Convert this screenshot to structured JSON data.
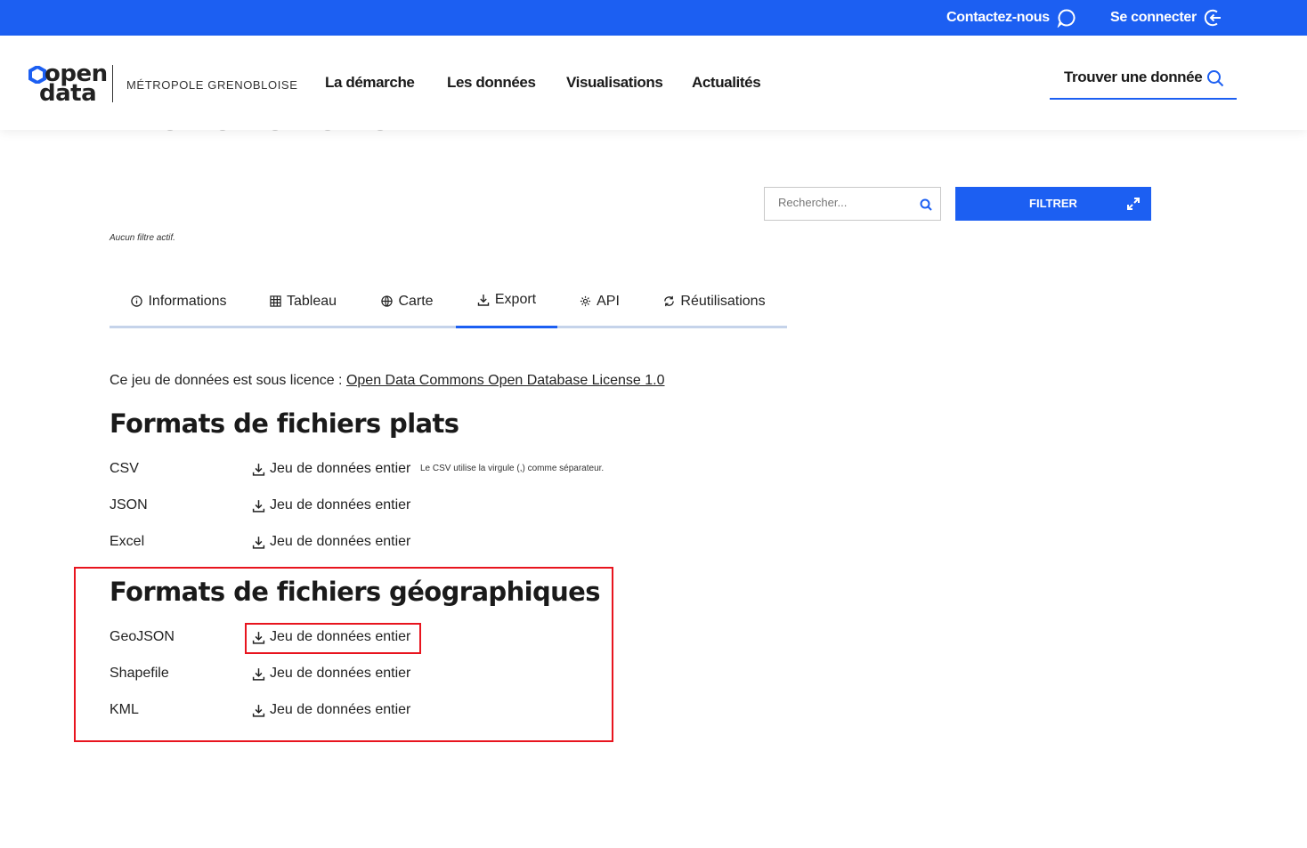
{
  "topbar": {
    "contact_label": "Contactez-nous",
    "contact_icon": "chat-bubble-icon",
    "login_label": "Se connecter",
    "login_icon": "login-arrow-icon"
  },
  "header": {
    "logo_line1": "open",
    "logo_line2": "data",
    "logo_subtitle": "MÉTROPOLE GRENOBLOISE",
    "nav": [
      "La démarche",
      "Les données",
      "Visualisations",
      "Actualités"
    ],
    "find_label": "Trouver une donnée"
  },
  "filters": {
    "search_placeholder": "Rechercher...",
    "filter_button": "FILTRER",
    "no_filter_text": "Aucun filtre actif."
  },
  "tabs": [
    {
      "label": "Informations",
      "icon": "info-circle-icon",
      "active": false
    },
    {
      "label": "Tableau",
      "icon": "table-grid-icon",
      "active": false
    },
    {
      "label": "Carte",
      "icon": "globe-icon",
      "active": false
    },
    {
      "label": "Export",
      "icon": "download-icon",
      "active": true
    },
    {
      "label": "API",
      "icon": "gear-icon",
      "active": false
    },
    {
      "label": "Réutilisations",
      "icon": "refresh-icon",
      "active": false
    }
  ],
  "content": {
    "licence_prefix": "Ce jeu de données est sous licence : ",
    "licence_link": "Open Data Commons Open Database License 1.0",
    "flat_title": "Formats de fichiers plats",
    "flat_formats": [
      {
        "name": "CSV",
        "link": "Jeu de données entier",
        "note": "Le CSV utilise la virgule (,) comme séparateur."
      },
      {
        "name": "JSON",
        "link": "Jeu de données entier"
      },
      {
        "name": "Excel",
        "link": "Jeu de données entier"
      }
    ],
    "geo_title": "Formats de fichiers géographiques",
    "geo_formats": [
      {
        "name": "GeoJSON",
        "link": "Jeu de données entier"
      },
      {
        "name": "Shapefile",
        "link": "Jeu de données entier"
      },
      {
        "name": "KML",
        "link": "Jeu de données entier"
      }
    ]
  },
  "colors": {
    "brand_blue": "#1c5ff2",
    "highlight_red": "#e8141e",
    "tab_underline": "#c5d3ea"
  }
}
